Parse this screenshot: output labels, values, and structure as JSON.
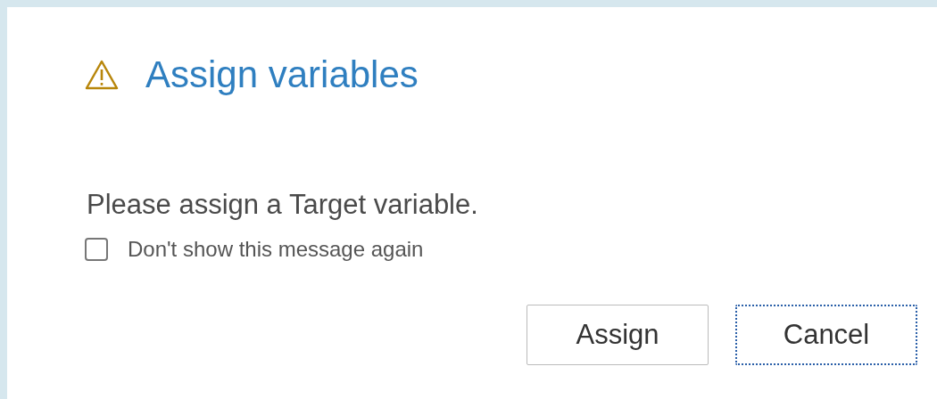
{
  "dialog": {
    "title": "Assign variables",
    "message": "Please assign a Target variable.",
    "checkbox": {
      "label": "Don't show this message again",
      "checked": false
    },
    "buttons": [
      {
        "label": "Assign",
        "focused": false
      },
      {
        "label": "Cancel",
        "focused": true
      }
    ]
  }
}
